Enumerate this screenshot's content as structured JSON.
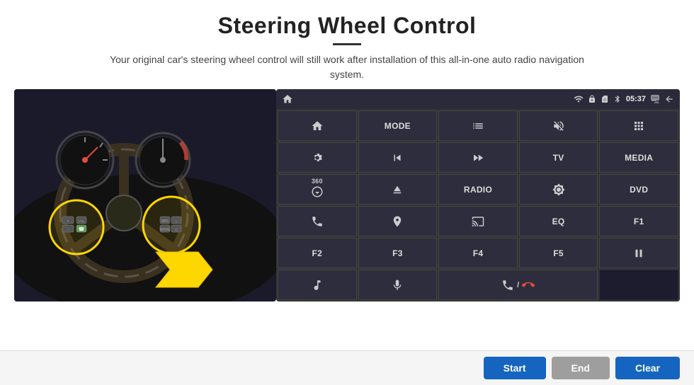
{
  "header": {
    "title": "Steering Wheel Control",
    "subtitle": "Your original car's steering wheel control will still work after installation of this all-in-one auto radio navigation system."
  },
  "status_bar": {
    "time": "05:37",
    "icons": [
      "wifi",
      "lock",
      "sim",
      "bluetooth",
      "screen",
      "back"
    ]
  },
  "grid_rows": [
    [
      {
        "type": "icon",
        "icon": "home",
        "label": "home"
      },
      {
        "type": "text",
        "label": "MODE"
      },
      {
        "type": "icon",
        "icon": "list",
        "label": "list"
      },
      {
        "type": "icon",
        "icon": "mute",
        "label": "mute"
      },
      {
        "type": "icon",
        "icon": "apps",
        "label": "apps"
      }
    ],
    [
      {
        "type": "icon",
        "icon": "settings-circle",
        "label": "settings"
      },
      {
        "type": "icon",
        "icon": "rewind",
        "label": "rewind"
      },
      {
        "type": "icon",
        "icon": "forward",
        "label": "forward"
      },
      {
        "type": "text",
        "label": "TV"
      },
      {
        "type": "text",
        "label": "MEDIA"
      }
    ],
    [
      {
        "type": "icon",
        "icon": "360-cam",
        "label": "360-camera"
      },
      {
        "type": "icon",
        "icon": "eject",
        "label": "eject"
      },
      {
        "type": "text",
        "label": "RADIO"
      },
      {
        "type": "icon",
        "icon": "brightness",
        "label": "brightness"
      },
      {
        "type": "text",
        "label": "DVD"
      }
    ],
    [
      {
        "type": "icon",
        "icon": "phone",
        "label": "phone"
      },
      {
        "type": "icon",
        "icon": "navi",
        "label": "navigation"
      },
      {
        "type": "icon",
        "icon": "screen-mirror",
        "label": "screen-mirror"
      },
      {
        "type": "text",
        "label": "EQ"
      },
      {
        "type": "text",
        "label": "F1"
      }
    ],
    [
      {
        "type": "text",
        "label": "F2"
      },
      {
        "type": "text",
        "label": "F3"
      },
      {
        "type": "text",
        "label": "F4"
      },
      {
        "type": "text",
        "label": "F5"
      },
      {
        "type": "icon",
        "icon": "play-pause",
        "label": "play-pause"
      }
    ],
    [
      {
        "type": "icon",
        "icon": "music",
        "label": "music"
      },
      {
        "type": "icon",
        "icon": "mic",
        "label": "microphone"
      },
      {
        "type": "icon",
        "icon": "phone-call",
        "label": "phone-call"
      },
      {
        "type": "empty",
        "label": ""
      },
      {
        "type": "empty",
        "label": ""
      }
    ]
  ],
  "buttons": {
    "start": "Start",
    "end": "End",
    "clear": "Clear"
  }
}
